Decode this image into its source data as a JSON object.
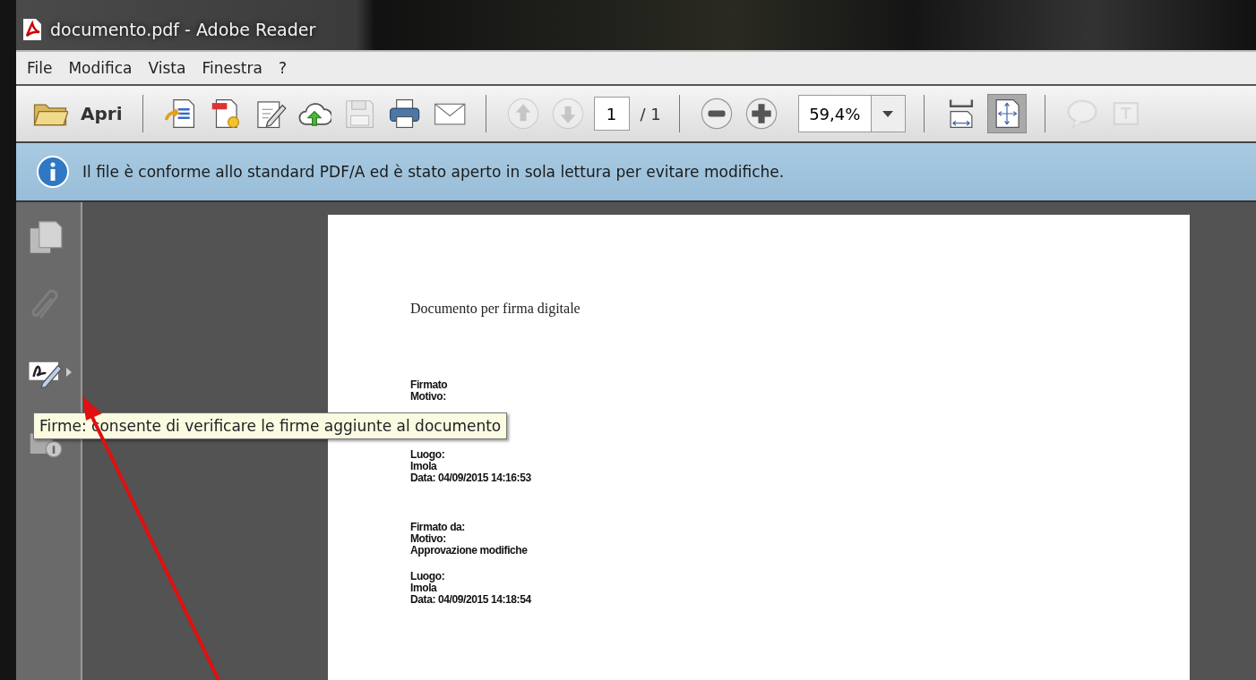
{
  "window": {
    "title": "documento.pdf - Adobe Reader"
  },
  "menu": [
    "File",
    "Modifica",
    "Vista",
    "Finestra",
    "?"
  ],
  "toolbar": {
    "items": [
      {
        "kind": "open",
        "label": "Apri",
        "disabled": false
      },
      {
        "kind": "sep"
      },
      {
        "kind": "create",
        "disabled": false
      },
      {
        "kind": "export",
        "disabled": false
      },
      {
        "kind": "sign",
        "disabled": false
      },
      {
        "kind": "upload",
        "disabled": false
      },
      {
        "kind": "save",
        "disabled": true
      },
      {
        "kind": "print",
        "disabled": false
      },
      {
        "kind": "mail",
        "disabled": false
      },
      {
        "kind": "sep"
      },
      {
        "kind": "up",
        "disabled": true
      },
      {
        "kind": "down",
        "disabled": true
      },
      {
        "kind": "page",
        "value": "1",
        "total": "/ 1"
      },
      {
        "kind": "sep"
      },
      {
        "kind": "zoomout",
        "disabled": false
      },
      {
        "kind": "zoomin",
        "disabled": false
      },
      {
        "kind": "zoom",
        "value": "59,4%"
      },
      {
        "kind": "sep"
      },
      {
        "kind": "fitwidth",
        "disabled": false,
        "selected": false
      },
      {
        "kind": "fitpage",
        "disabled": false,
        "selected": true
      },
      {
        "kind": "sep"
      },
      {
        "kind": "comment",
        "disabled": true
      },
      {
        "kind": "typewriter",
        "disabled": true
      }
    ]
  },
  "info_bar": {
    "message": "Il file è conforme allo standard PDF/A ed è stato aperto in sola lettura per evitare modifiche."
  },
  "side_panel": [
    {
      "kind": "pages",
      "disabled": false
    },
    {
      "kind": "attachment",
      "disabled": true
    },
    {
      "kind": "signatures",
      "disabled": false
    },
    {
      "kind": "security",
      "disabled": false
    }
  ],
  "document": {
    "title": "Documento per firma digitale",
    "blocks": [
      [
        [
          "Firmato",
          "Motivo:"
        ],
        [
          "Luogo:",
          "Imola",
          "Data: 04/09/2015 14:16:53"
        ]
      ],
      [
        [
          "Firmato da:",
          "Motivo:",
          "Approvazione modifiche"
        ],
        [
          "Luogo:",
          "Imola",
          "Data: 04/09/2015 14:18:54"
        ]
      ]
    ]
  },
  "tooltip": {
    "text": "Firme: consente di verificare le firme aggiunte al documento"
  }
}
